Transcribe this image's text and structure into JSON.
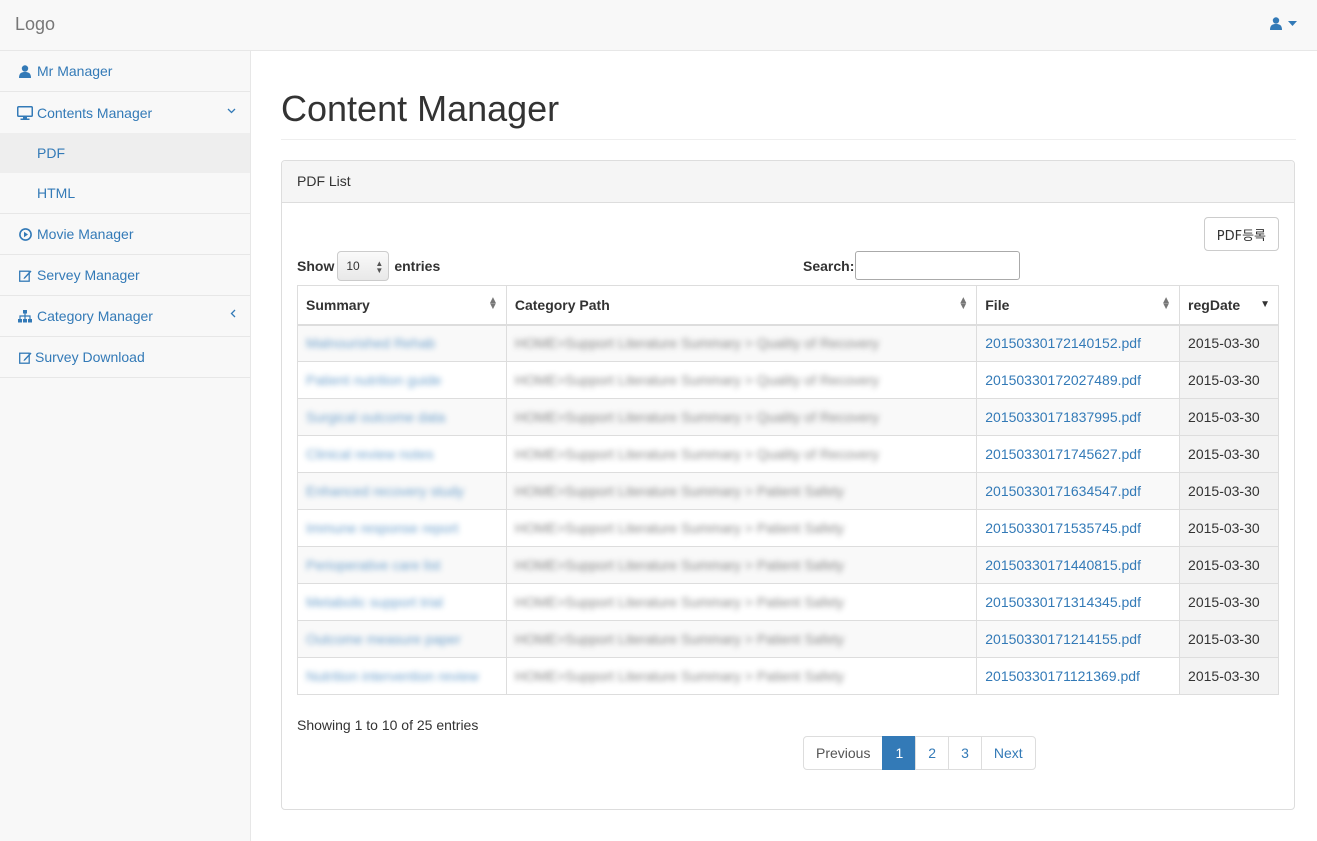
{
  "topbar": {
    "logo": "Logo",
    "user_icon": "user-icon",
    "caret_icon": "caret-down-icon"
  },
  "sidebar": {
    "items": [
      {
        "label": "Mr Manager",
        "icon": "user-icon"
      },
      {
        "label": "Contents Manager",
        "icon": "desktop-icon",
        "arrow": "chevron-down-icon",
        "children": [
          {
            "label": "PDF",
            "active": true
          },
          {
            "label": "HTML"
          }
        ]
      },
      {
        "label": "Movie Manager",
        "icon": "play-circle-icon"
      },
      {
        "label": "Servey Manager",
        "icon": "edit-icon"
      },
      {
        "label": "Category Manager",
        "icon": "sitemap-icon",
        "arrow": "chevron-left-icon"
      },
      {
        "label": "Survey Download",
        "icon": "edit-icon"
      }
    ]
  },
  "main": {
    "title": "Content Manager",
    "panel": {
      "heading": "PDF List",
      "add_button": "PDF등록",
      "length": {
        "show": "Show",
        "value": "10",
        "entries": "entries"
      },
      "search": {
        "label": "Search:",
        "value": ""
      },
      "columns": [
        "Summary",
        "Category Path",
        "File",
        "regDate"
      ],
      "rows": [
        {
          "summary": "Malnourished Rehab",
          "path": "HOME>Support Literature Summary > Quality of Recovery",
          "file": "20150330172140152.pdf",
          "date": "2015-03-30"
        },
        {
          "summary": "Patient nutrition guide",
          "path": "HOME>Support Literature Summary > Quality of Recovery",
          "file": "20150330172027489.pdf",
          "date": "2015-03-30"
        },
        {
          "summary": "Surgical outcome data",
          "path": "HOME>Support Literature Summary > Quality of Recovery",
          "file": "20150330171837995.pdf",
          "date": "2015-03-30"
        },
        {
          "summary": "Clinical review notes",
          "path": "HOME>Support Literature Summary > Quality of Recovery",
          "file": "20150330171745627.pdf",
          "date": "2015-03-30"
        },
        {
          "summary": "Enhanced recovery study",
          "path": "HOME>Support Literature Summary > Patient Safety",
          "file": "20150330171634547.pdf",
          "date": "2015-03-30"
        },
        {
          "summary": "Immune response report",
          "path": "HOME>Support Literature Summary > Patient Safety",
          "file": "20150330171535745.pdf",
          "date": "2015-03-30"
        },
        {
          "summary": "Perioperative care list",
          "path": "HOME>Support Literature Summary > Patient Safety",
          "file": "20150330171440815.pdf",
          "date": "2015-03-30"
        },
        {
          "summary": "Metabolic support trial",
          "path": "HOME>Support Literature Summary > Patient Safety",
          "file": "20150330171314345.pdf",
          "date": "2015-03-30"
        },
        {
          "summary": "Outcome measure paper",
          "path": "HOME>Support Literature Summary > Patient Safety",
          "file": "20150330171214155.pdf",
          "date": "2015-03-30"
        },
        {
          "summary": "Nutrition intervention review",
          "path": "HOME>Support Literature Summary > Patient Safety",
          "file": "20150330171121369.pdf",
          "date": "2015-03-30"
        }
      ],
      "info": "Showing 1 to 10 of 25 entries",
      "pagination": {
        "previous": "Previous",
        "pages": [
          "1",
          "2",
          "3"
        ],
        "current": "1",
        "next": "Next"
      }
    }
  },
  "colors": {
    "link": "#337ab7",
    "active_page": "#337ab7",
    "navbar_bg": "#f8f8f8"
  }
}
